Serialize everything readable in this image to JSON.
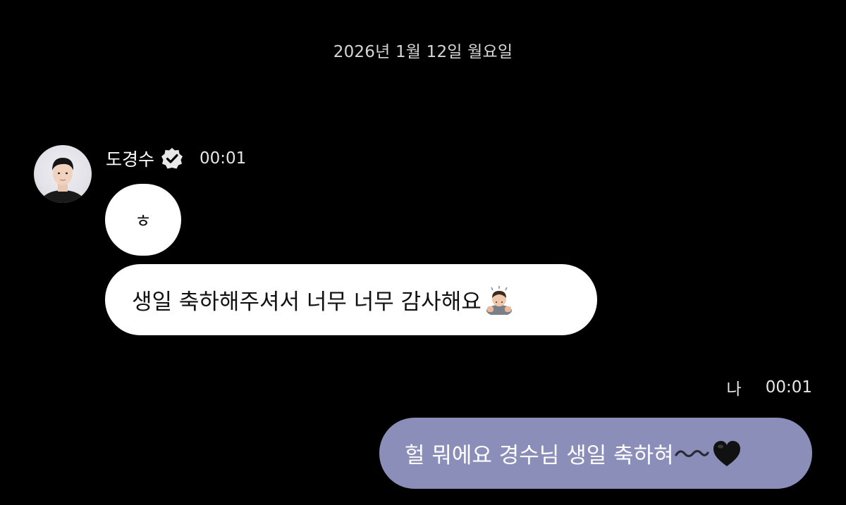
{
  "date_divider": "2026년 1월 12일 월요일",
  "incoming": {
    "sender_name": "도경수",
    "time": "00:01",
    "verified_icon": "verified-check-icon",
    "messages": [
      {
        "text": "ㅎ"
      },
      {
        "text": "생일 축하해주셔서 너무 너무 감사해요",
        "trailing_icon": "person-bowing-emoji"
      }
    ]
  },
  "outgoing": {
    "sender_label": "나",
    "time": "00:01",
    "messages": [
      {
        "text": "헐 뭐에요 경수님 생일 축하혀",
        "trailing_icons": [
          "wavy-dash-decoration",
          "black-heart-icon"
        ]
      }
    ]
  },
  "colors": {
    "background": "#000000",
    "incoming_bubble": "#ffffff",
    "outgoing_bubble": "#8a8eb8",
    "meta_text": "#d6d6d6"
  }
}
